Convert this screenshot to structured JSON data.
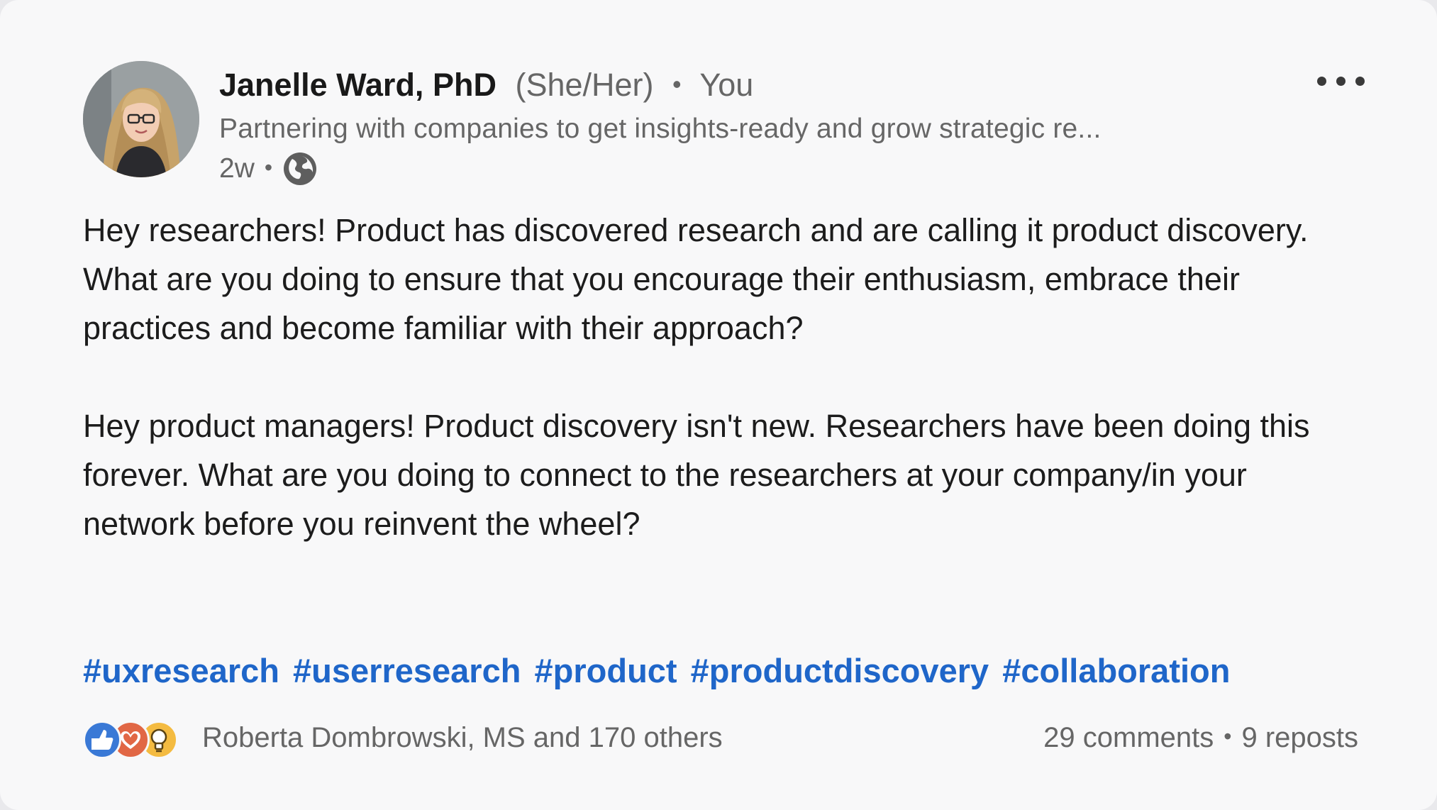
{
  "post": {
    "author": {
      "name": "Janelle Ward, PhD",
      "pronouns": "(She/Her)",
      "relation": "You",
      "headline": "Partnering with companies to get insights-ready and grow strategic re...",
      "posted_ago": "2w",
      "visibility_icon": "globe-icon"
    },
    "menu_icon": "more-horizontal-icon",
    "body": {
      "paragraph_1": "Hey researchers! Product has discovered research and are calling it product discovery. What are you doing to ensure that you encourage their enthusiasm, embrace their practices and become familiar with their approach?",
      "paragraph_2": "Hey product managers! Product discovery isn't new. Researchers have been doing this forever. What are you doing to connect to the researchers at your company/in your network before you reinvent the wheel?"
    },
    "hashtags": [
      "#uxresearch",
      "#userresearch",
      "#product",
      "#productdiscovery",
      "#collaboration"
    ],
    "reactions": {
      "icons": [
        "like-icon",
        "love-icon",
        "insightful-icon"
      ],
      "summary": "Roberta Dombrowski, MS and 170 others"
    },
    "counts": {
      "comments": "29 comments",
      "reposts": "9 reposts"
    }
  },
  "colors": {
    "card_background": "#f8f8f9",
    "hashtag_blue": "#1f66c9",
    "secondary_text": "#666666",
    "primary_text": "#1c1c1c"
  }
}
